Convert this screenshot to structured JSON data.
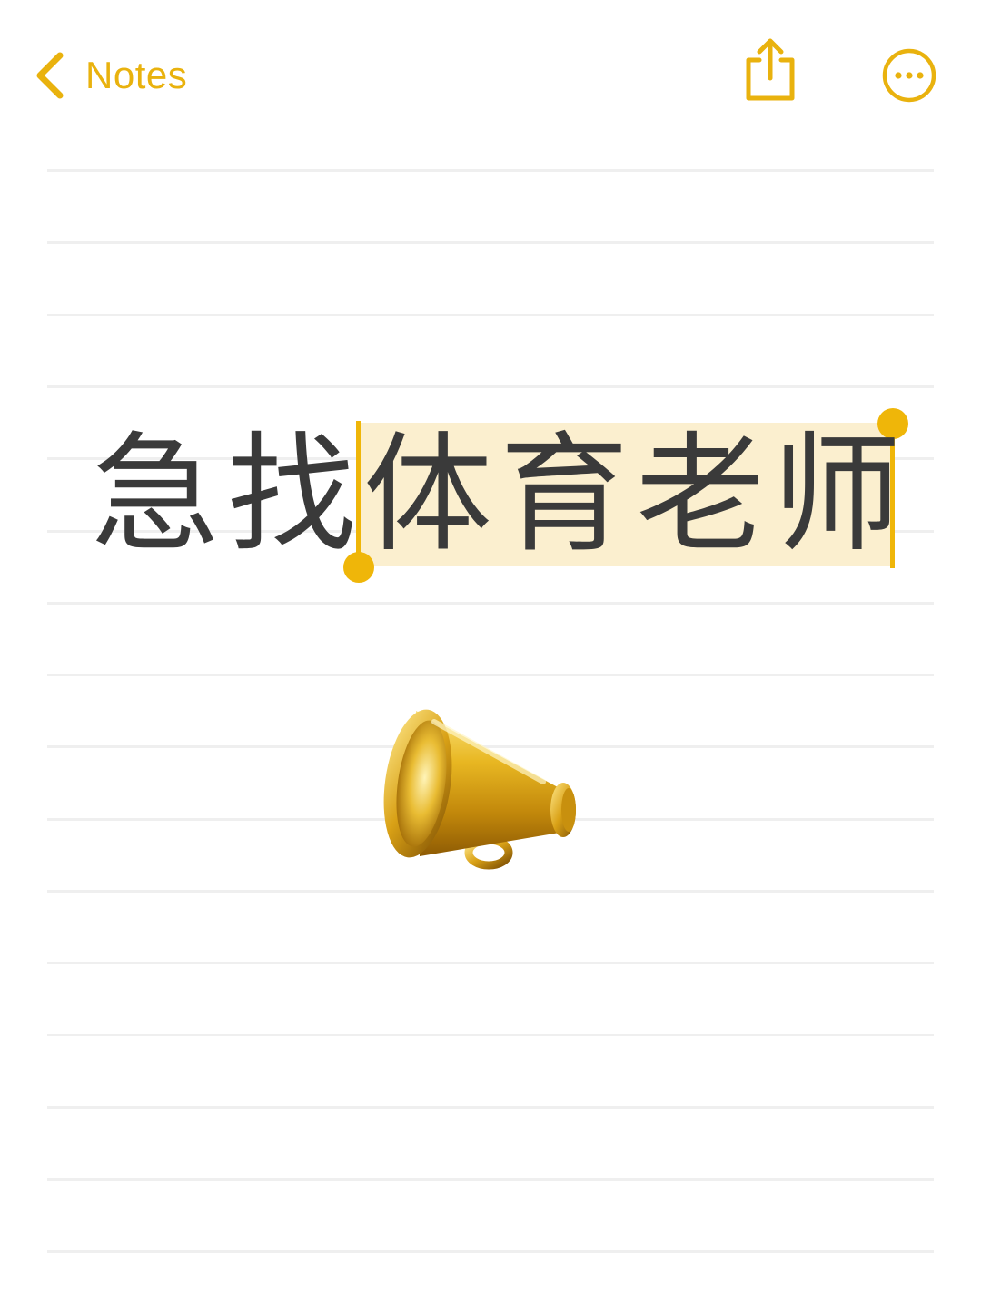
{
  "nav": {
    "back_label": "Notes",
    "back_icon": "chevron-left-icon",
    "share_icon": "share-icon",
    "more_icon": "ellipsis-circle-icon"
  },
  "note": {
    "headline_plain": "急找",
    "headline_selected": "体育老师",
    "emoji": "megaphone-icon"
  },
  "colors": {
    "accent": "#EFB609",
    "selection": "#FBEFCF",
    "text": "#3a3a3a",
    "rule": "#efefef"
  }
}
